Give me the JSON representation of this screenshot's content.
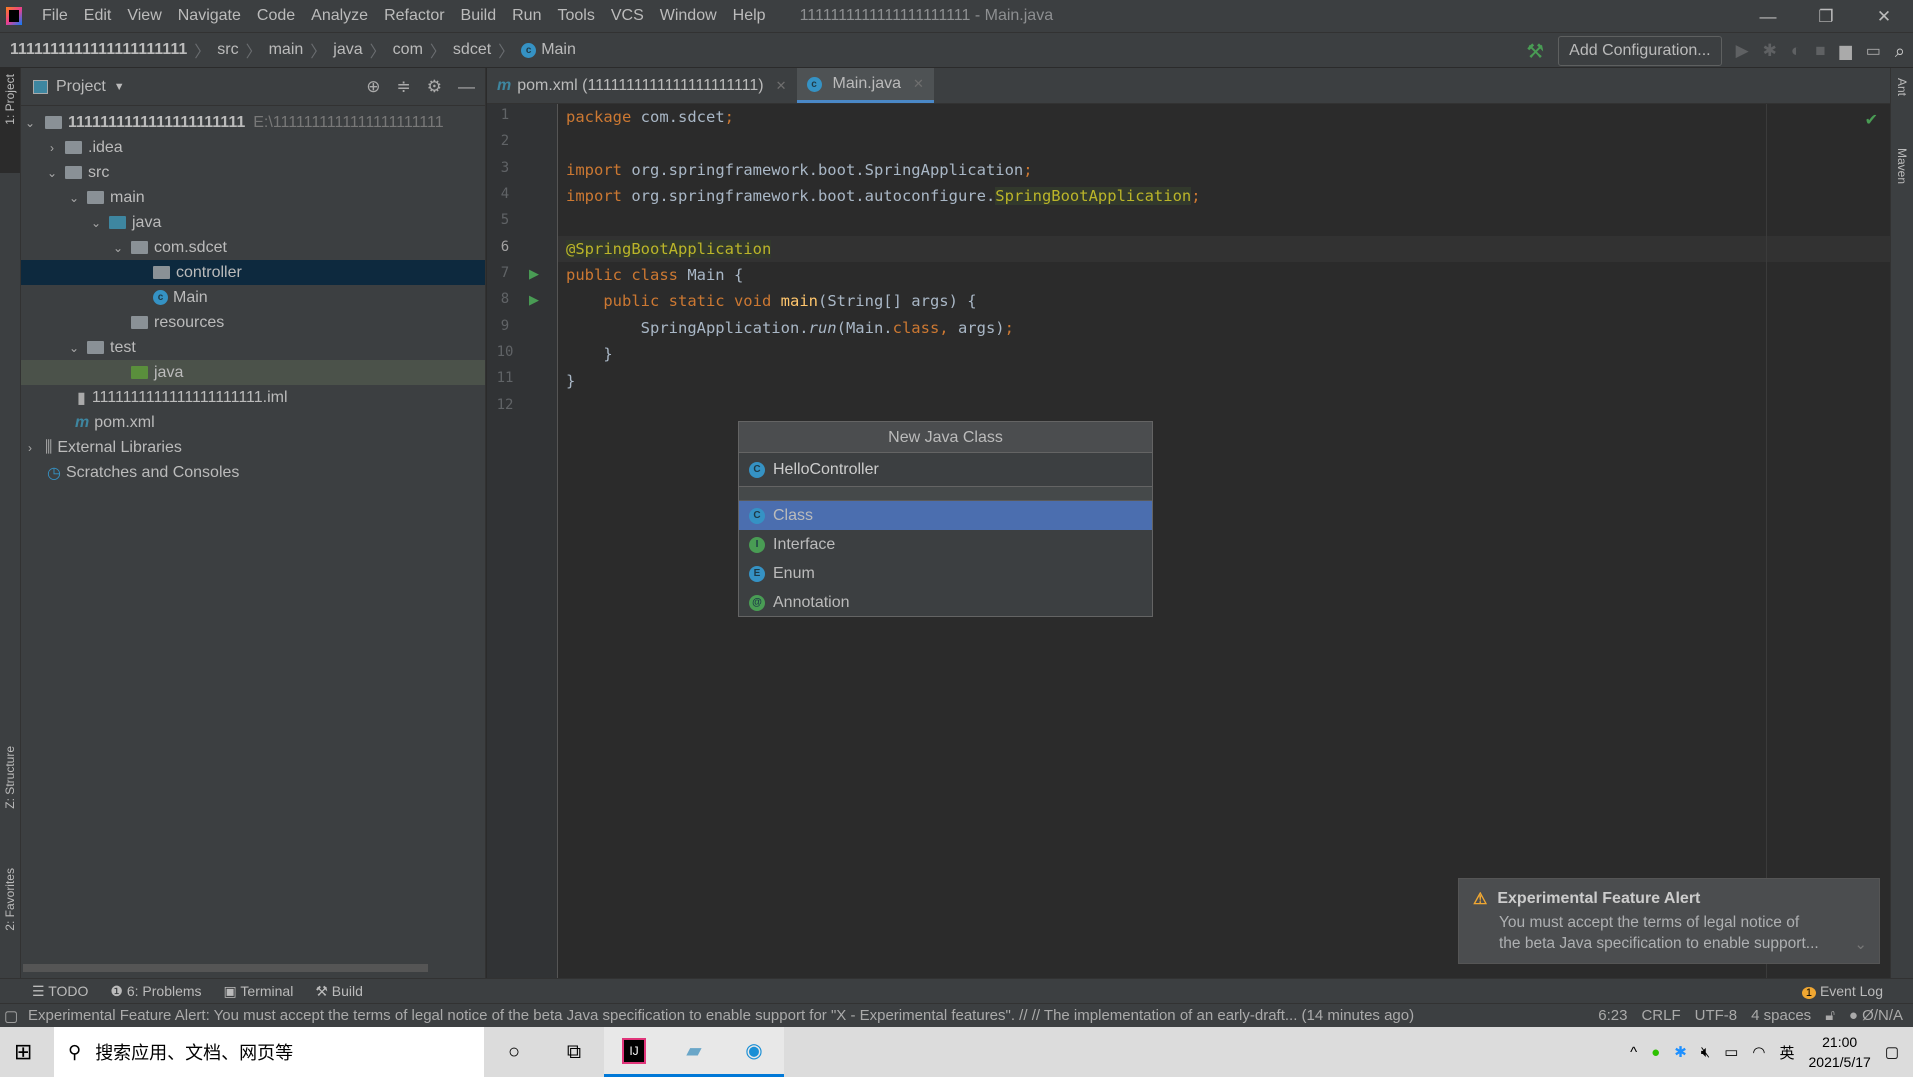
{
  "window": {
    "title": "1111111111111111111111 - Main.java",
    "menu": [
      "File",
      "Edit",
      "View",
      "Navigate",
      "Code",
      "Analyze",
      "Refactor",
      "Build",
      "Run",
      "Tools",
      "VCS",
      "Window",
      "Help"
    ]
  },
  "breadcrumb": [
    "1111111111111111111111",
    "src",
    "main",
    "java",
    "com",
    "sdcet",
    "Main"
  ],
  "toolbar": {
    "add_config": "Add Configuration..."
  },
  "stripes": {
    "project": "1: Project",
    "structure": "Z: Structure",
    "favorites": "2: Favorites",
    "ant": "Ant",
    "maven": "Maven"
  },
  "project": {
    "title": "Project",
    "root": "1111111111111111111111",
    "root_path": "E:\\1111111111111111111111",
    "items": [
      ".idea",
      "src",
      "main",
      "java",
      "com.sdcet",
      "controller",
      "Main",
      "resources",
      "test",
      "java",
      "1111111111111111111111.iml",
      "pom.xml",
      "External Libraries",
      "Scratches and Consoles"
    ]
  },
  "tabs": [
    {
      "label": "pom.xml (1111111111111111111111)"
    },
    {
      "label": "Main.java"
    }
  ],
  "code": {
    "lines": [
      "1",
      "2",
      "3",
      "4",
      "5",
      "6",
      "7",
      "8",
      "9",
      "10",
      "11",
      "12"
    ]
  },
  "popup": {
    "title": "New Java Class",
    "input": "HelloController",
    "items": [
      {
        "label": "Class",
        "icon": "C",
        "color": "#3592c4"
      },
      {
        "label": "Interface",
        "icon": "I",
        "color": "#499c54"
      },
      {
        "label": "Enum",
        "icon": "E",
        "color": "#3592c4"
      },
      {
        "label": "Annotation",
        "icon": "@",
        "color": "#499c54"
      }
    ],
    "selected": "Class"
  },
  "notification": {
    "title": "Experimental Feature Alert",
    "body1": "You must accept the terms of legal notice of",
    "body2": "the beta Java specification to enable support..."
  },
  "toolwindows": [
    "TODO",
    "6: Problems",
    "Terminal",
    "Build"
  ],
  "event_log": "Event Log",
  "event_count": "1",
  "status": {
    "message": "Experimental Feature Alert: You must accept the terms of legal notice of the beta Java specification to enable support for \"X - Experimental features\". // // The implementation of an early-draft... (14 minutes ago)",
    "position": "6:23",
    "line_sep": "CRLF",
    "encoding": "UTF-8",
    "indent": "4 spaces",
    "vcs": "Ø/N/A"
  },
  "taskbar": {
    "search": "搜索应用、文档、网页等",
    "time": "21:00",
    "date": "2021/5/17",
    "ime": "英"
  }
}
